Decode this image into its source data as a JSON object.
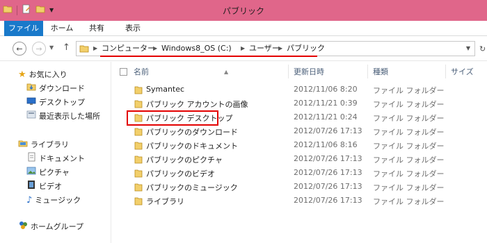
{
  "window": {
    "title": "パブリック"
  },
  "ribbon": {
    "tabs": [
      "ファイル",
      "ホーム",
      "共有",
      "表示"
    ]
  },
  "address": {
    "crumbs": [
      "コンピューター",
      "Windows8_OS (C:)",
      "ユーザー",
      "パブリック"
    ]
  },
  "navpane": {
    "favorites": {
      "label": "お気に入り",
      "items": [
        "ダウンロード",
        "デスクトップ",
        "最近表示した場所"
      ]
    },
    "libraries": {
      "label": "ライブラリ",
      "items": [
        "ドキュメント",
        "ピクチャ",
        "ビデオ",
        "ミュージック"
      ]
    },
    "homegroup": {
      "label": "ホームグループ"
    }
  },
  "columns": {
    "name": "名前",
    "date": "更新日時",
    "type": "種類",
    "size": "サイズ"
  },
  "files": [
    {
      "name": "Symantec",
      "date": "2012/11/06 8:20",
      "type": "ファイル フォルダー"
    },
    {
      "name": "パブリック アカウントの画像",
      "date": "2012/11/21 0:39",
      "type": "ファイル フォルダー"
    },
    {
      "name": "パブリック デスクトップ",
      "date": "2012/11/21 0:24",
      "type": "ファイル フォルダー"
    },
    {
      "name": "パブリックのダウンロード",
      "date": "2012/07/26 17:13",
      "type": "ファイル フォルダー"
    },
    {
      "name": "パブリックのドキュメント",
      "date": "2012/11/06 8:16",
      "type": "ファイル フォルダー"
    },
    {
      "name": "パブリックのピクチャ",
      "date": "2012/07/26 17:13",
      "type": "ファイル フォルダー"
    },
    {
      "name": "パブリックのビデオ",
      "date": "2012/07/26 17:13",
      "type": "ファイル フォルダー"
    },
    {
      "name": "パブリックのミュージック",
      "date": "2012/07/26 17:13",
      "type": "ファイル フォルダー"
    },
    {
      "name": "ライブラリ",
      "date": "2012/07/26 17:13",
      "type": "ファイル フォルダー"
    }
  ],
  "colors": {
    "titlebar": "#e0668a",
    "file_tab": "#1979ca",
    "highlight": "#e30000",
    "folder": "#e8b94a"
  }
}
